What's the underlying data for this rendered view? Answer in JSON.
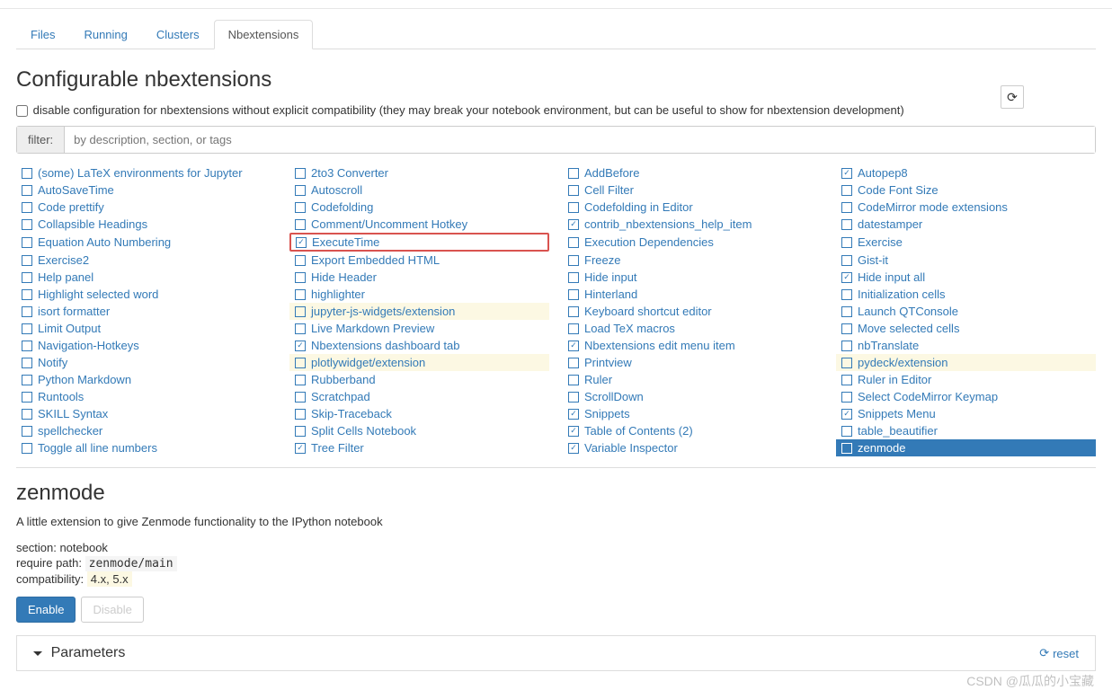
{
  "tabs": [
    "Files",
    "Running",
    "Clusters",
    "Nbextensions"
  ],
  "active_tab": 3,
  "page_title": "Configurable nbextensions",
  "compat_label": "disable configuration for nbextensions without explicit compatibility (they may break your notebook environment, but can be useful to show for nbextension development)",
  "filter_label": "filter:",
  "filter_placeholder": "by description, section, or tags",
  "extensions": [
    {
      "name": "(some) LaTeX environments for Jupyter",
      "checked": false,
      "col": 0
    },
    {
      "name": "AutoSaveTime",
      "checked": false,
      "col": 0
    },
    {
      "name": "Code prettify",
      "checked": false,
      "col": 0
    },
    {
      "name": "Collapsible Headings",
      "checked": false,
      "col": 0
    },
    {
      "name": "Equation Auto Numbering",
      "checked": false,
      "col": 0
    },
    {
      "name": "Exercise2",
      "checked": false,
      "col": 0
    },
    {
      "name": "Help panel",
      "checked": false,
      "col": 0
    },
    {
      "name": "Highlight selected word",
      "checked": false,
      "col": 0
    },
    {
      "name": "isort formatter",
      "checked": false,
      "col": 0
    },
    {
      "name": "Limit Output",
      "checked": false,
      "col": 0
    },
    {
      "name": "Navigation-Hotkeys",
      "checked": false,
      "col": 0
    },
    {
      "name": "Notify",
      "checked": false,
      "col": 0
    },
    {
      "name": "Python Markdown",
      "checked": false,
      "col": 0
    },
    {
      "name": "Runtools",
      "checked": false,
      "col": 0
    },
    {
      "name": "SKILL Syntax",
      "checked": false,
      "col": 0
    },
    {
      "name": "spellchecker",
      "checked": false,
      "col": 0
    },
    {
      "name": "Toggle all line numbers",
      "checked": false,
      "col": 0
    },
    {
      "name": "2to3 Converter",
      "checked": false,
      "col": 1
    },
    {
      "name": "Autoscroll",
      "checked": false,
      "col": 1
    },
    {
      "name": "Codefolding",
      "checked": false,
      "col": 1
    },
    {
      "name": "Comment/Uncomment Hotkey",
      "checked": false,
      "col": 1
    },
    {
      "name": "ExecuteTime",
      "checked": true,
      "col": 1,
      "highlighted": true
    },
    {
      "name": "Export Embedded HTML",
      "checked": false,
      "col": 1
    },
    {
      "name": "Hide Header",
      "checked": false,
      "col": 1
    },
    {
      "name": "highlighter",
      "checked": false,
      "col": 1
    },
    {
      "name": "jupyter-js-widgets/extension",
      "checked": false,
      "col": 1,
      "incompatible": true
    },
    {
      "name": "Live Markdown Preview",
      "checked": false,
      "col": 1
    },
    {
      "name": "Nbextensions dashboard tab",
      "checked": true,
      "col": 1
    },
    {
      "name": "plotlywidget/extension",
      "checked": false,
      "col": 1,
      "incompatible": true
    },
    {
      "name": "Rubberband",
      "checked": false,
      "col": 1
    },
    {
      "name": "Scratchpad",
      "checked": false,
      "col": 1
    },
    {
      "name": "Skip-Traceback",
      "checked": false,
      "col": 1
    },
    {
      "name": "Split Cells Notebook",
      "checked": false,
      "col": 1
    },
    {
      "name": "Tree Filter",
      "checked": true,
      "col": 1
    },
    {
      "name": "AddBefore",
      "checked": false,
      "col": 2
    },
    {
      "name": "Cell Filter",
      "checked": false,
      "col": 2
    },
    {
      "name": "Codefolding in Editor",
      "checked": false,
      "col": 2
    },
    {
      "name": "contrib_nbextensions_help_item",
      "checked": true,
      "col": 2
    },
    {
      "name": "Execution Dependencies",
      "checked": false,
      "col": 2
    },
    {
      "name": "Freeze",
      "checked": false,
      "col": 2
    },
    {
      "name": "Hide input",
      "checked": false,
      "col": 2
    },
    {
      "name": "Hinterland",
      "checked": false,
      "col": 2
    },
    {
      "name": "Keyboard shortcut editor",
      "checked": false,
      "col": 2
    },
    {
      "name": "Load TeX macros",
      "checked": false,
      "col": 2
    },
    {
      "name": "Nbextensions edit menu item",
      "checked": true,
      "col": 2
    },
    {
      "name": "Printview",
      "checked": false,
      "col": 2
    },
    {
      "name": "Ruler",
      "checked": false,
      "col": 2
    },
    {
      "name": "ScrollDown",
      "checked": false,
      "col": 2
    },
    {
      "name": "Snippets",
      "checked": true,
      "col": 2
    },
    {
      "name": "Table of Contents (2)",
      "checked": true,
      "col": 2
    },
    {
      "name": "Variable Inspector",
      "checked": true,
      "col": 2
    },
    {
      "name": "Autopep8",
      "checked": true,
      "col": 3
    },
    {
      "name": "Code Font Size",
      "checked": false,
      "col": 3
    },
    {
      "name": "CodeMirror mode extensions",
      "checked": false,
      "col": 3
    },
    {
      "name": "datestamper",
      "checked": false,
      "col": 3
    },
    {
      "name": "Exercise",
      "checked": false,
      "col": 3
    },
    {
      "name": "Gist-it",
      "checked": false,
      "col": 3
    },
    {
      "name": "Hide input all",
      "checked": true,
      "col": 3
    },
    {
      "name": "Initialization cells",
      "checked": false,
      "col": 3
    },
    {
      "name": "Launch QTConsole",
      "checked": false,
      "col": 3
    },
    {
      "name": "Move selected cells",
      "checked": false,
      "col": 3
    },
    {
      "name": "nbTranslate",
      "checked": false,
      "col": 3
    },
    {
      "name": "pydeck/extension",
      "checked": false,
      "col": 3,
      "incompatible": true
    },
    {
      "name": "Ruler in Editor",
      "checked": false,
      "col": 3
    },
    {
      "name": "Select CodeMirror Keymap",
      "checked": false,
      "col": 3
    },
    {
      "name": "Snippets Menu",
      "checked": true,
      "col": 3
    },
    {
      "name": "table_beautifier",
      "checked": false,
      "col": 3
    },
    {
      "name": "zenmode",
      "checked": false,
      "col": 3,
      "selected": true
    }
  ],
  "detail": {
    "title": "zenmode",
    "description": "A little extension to give Zenmode functionality to the IPython notebook",
    "section_label": "section:",
    "section_value": "notebook",
    "require_label": "require path:",
    "require_value": "zenmode/main",
    "compat_label": "compatibility:",
    "compat_value": "4.x, 5.x",
    "enable_label": "Enable",
    "disable_label": "Disable"
  },
  "params_title": "Parameters",
  "reset_label": "reset",
  "watermark": "CSDN @瓜瓜的小宝藏"
}
